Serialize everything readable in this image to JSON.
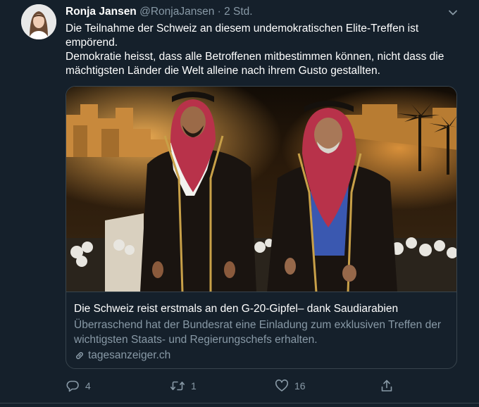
{
  "tweet": {
    "author_name": "Ronja Jansen",
    "author_handle": "@RonjaJansen",
    "separator": "·",
    "time": "2 Std.",
    "text_line1": "Die Teilnahme der Schweiz an diesem undemokratischen Elite-Treffen ist empörend.",
    "text_line2": "Demokratie heisst, dass alle Betroffenen mitbestimmen können, nicht dass die mächtigsten Länder die Welt alleine nach ihrem Gusto gestallten."
  },
  "card": {
    "title": "Die Schweiz reist erstmals an den G-20-Gipfel– dank Saudiarabien",
    "description": "Überraschend hat der Bundesrat eine Einladung zum exklusiven Treffen der wichtigsten Staats- und Regierungschefs erhalten.",
    "domain": "tagesanzeiger.ch"
  },
  "actions": {
    "reply_count": "4",
    "retweet_count": "1",
    "like_count": "16"
  },
  "icons": {
    "menu": "chevron-down-icon",
    "reply": "reply-icon",
    "retweet": "retweet-icon",
    "like": "heart-icon",
    "share": "share-icon",
    "link": "link-icon"
  },
  "colors": {
    "background": "#15202b",
    "secondary_text": "#8899a6",
    "border": "#38444d"
  }
}
